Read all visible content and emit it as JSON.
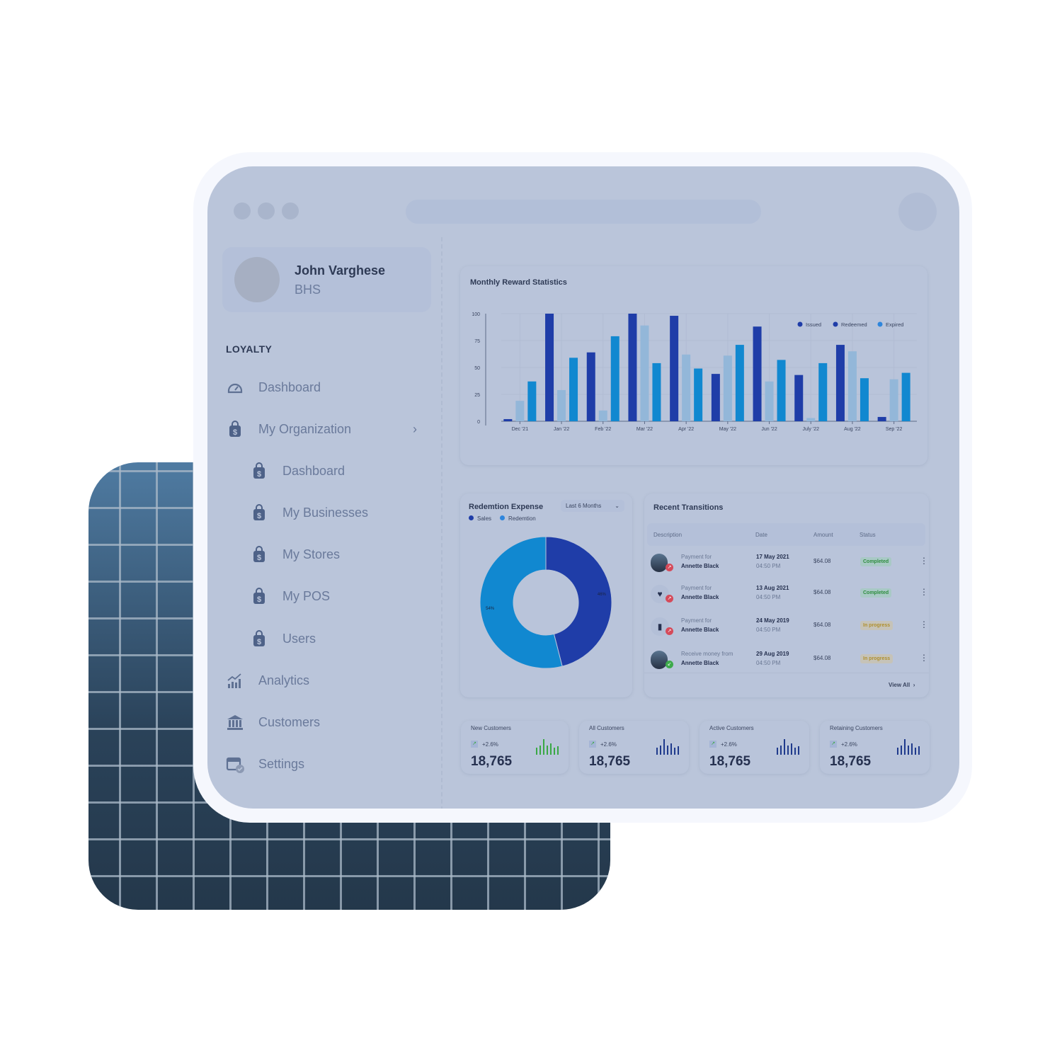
{
  "profile": {
    "name": "John Varghese",
    "org": "BHS"
  },
  "sidebar": {
    "section": "LOYALTY",
    "items": [
      {
        "label": "Dashboard",
        "icon": "speedometer-icon"
      },
      {
        "label": "My Organization",
        "icon": "shopping-bag-dollar-icon",
        "expandable": true
      },
      {
        "label": "Dashboard",
        "icon": "shopping-bag-dollar-icon",
        "sub": true
      },
      {
        "label": "My Businesses",
        "icon": "shopping-bag-dollar-icon",
        "sub": true
      },
      {
        "label": "My Stores",
        "icon": "shopping-bag-dollar-icon",
        "sub": true
      },
      {
        "label": "My POS",
        "icon": "shopping-bag-dollar-icon",
        "sub": true
      },
      {
        "label": "Users",
        "icon": "shopping-bag-dollar-icon",
        "sub": true
      },
      {
        "label": "Analytics",
        "icon": "analytics-icon"
      },
      {
        "label": "Customers",
        "icon": "bank-icon"
      },
      {
        "label": "Settings",
        "icon": "calendar-check-icon"
      }
    ]
  },
  "chart_data": [
    {
      "type": "bar",
      "title": "Monthly Reward Statistics",
      "categories": [
        "Dec '21",
        "Jan '22",
        "Feb '22",
        "Mar '22",
        "Apr '22",
        "May '22",
        "Jun '22",
        "July '22",
        "Aug '22",
        "Sep '22"
      ],
      "ylim": [
        0,
        100
      ],
      "yticks": [
        0,
        25,
        50,
        75,
        100
      ],
      "grid": true,
      "legend": "top-right",
      "series": [
        {
          "name": "Issued",
          "color": "#1f3da8",
          "values": [
            2,
            100,
            64,
            100,
            98,
            44,
            88,
            43,
            71,
            4
          ]
        },
        {
          "name": "Redeemed",
          "color": "#93b7d9",
          "legend_color": "#1f3da8",
          "values": [
            19,
            29,
            10,
            89,
            62,
            61,
            37,
            3,
            65,
            39
          ]
        },
        {
          "name": "Expired",
          "color": "#1188d0",
          "legend_color": "#2f86dc",
          "values": [
            37,
            59,
            79,
            54,
            49,
            71,
            57,
            54,
            40,
            45
          ]
        }
      ]
    },
    {
      "type": "pie",
      "title": "Redemtion Expense",
      "filter": "Last 6 Months",
      "series": [
        {
          "name": "Sales",
          "value": 46,
          "label": "46%",
          "color": "#1f3da8"
        },
        {
          "name": "Redemtion",
          "value": 54,
          "label": "54%",
          "color": "#1188d0"
        }
      ]
    }
  ],
  "transactions": {
    "title": "Recent Transitions",
    "headers": [
      "Description",
      "Date",
      "Amount",
      "Status"
    ],
    "view_all": "View All",
    "rows": [
      {
        "avatar": "person-photo",
        "direction": "out",
        "desc": "Payment for",
        "name": "Annette Black",
        "date": "17 May 2021",
        "time": "04:50 PM",
        "amount": "$64.08",
        "status": "Completed"
      },
      {
        "avatar": "heart-icon",
        "direction": "out",
        "desc": "Payment for",
        "name": "Annette Black",
        "date": "13 Aug 2021",
        "time": "04:50 PM",
        "amount": "$64.08",
        "status": "Completed"
      },
      {
        "avatar": "book-icon",
        "direction": "out",
        "desc": "Payment for",
        "name": "Annette Black",
        "date": "24 May 2019",
        "time": "04:50 PM",
        "amount": "$64.08",
        "status": "In progress"
      },
      {
        "avatar": "person-photo",
        "direction": "in",
        "desc": "Receive money from",
        "name": "Annette Black",
        "date": "29 Aug 2019",
        "time": "04:50 PM",
        "amount": "$64.08",
        "status": "In progress"
      }
    ]
  },
  "stats": [
    {
      "label": "New Customers",
      "change": "+2.6%",
      "value": "18,765",
      "spark_color": "#3aa845"
    },
    {
      "label": "All Customers",
      "change": "+2.6%",
      "value": "18,765",
      "spark_color": "#1f3a8c"
    },
    {
      "label": "Active Customers",
      "change": "+2.6%",
      "value": "18,765",
      "spark_color": "#1f3a8c"
    },
    {
      "label": "Retaining Customers",
      "change": "+2.6%",
      "value": "18,765",
      "spark_color": "#1f3a8c"
    }
  ]
}
